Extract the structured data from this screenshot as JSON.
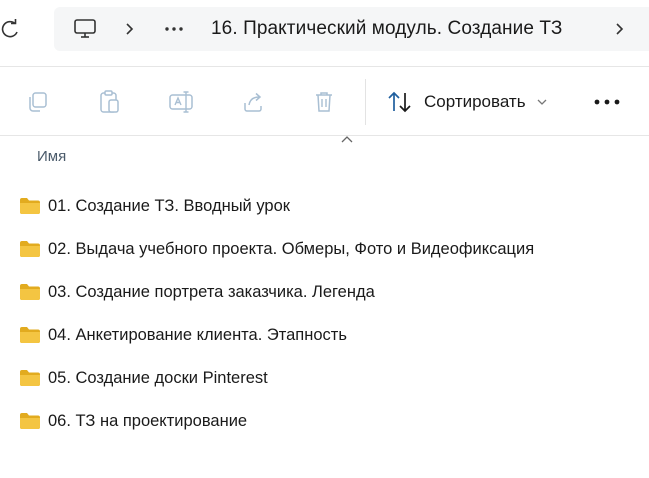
{
  "address_bar": {
    "refresh_icon": "refresh-icon",
    "location_icon": "monitor-icon",
    "separator_icon": "chevron-right-icon",
    "overflow_icon": "ellipsis-icon",
    "path_label": "16. Практический модуль. Создание ТЗ",
    "next_icon": "chevron-right-icon"
  },
  "command_bar": {
    "buttons": [
      {
        "name": "copy",
        "icon": "copy-icon",
        "enabled": false
      },
      {
        "name": "paste",
        "icon": "paste-icon",
        "enabled": false
      },
      {
        "name": "rename",
        "icon": "rename-icon",
        "enabled": false
      },
      {
        "name": "share",
        "icon": "share-icon",
        "enabled": false
      },
      {
        "name": "delete",
        "icon": "trash-icon",
        "enabled": false
      }
    ],
    "sort_label": "Сортировать",
    "more_icon": "more-dots-icon"
  },
  "list": {
    "column_header": "Имя",
    "items": [
      {
        "name": "01. Создание ТЗ. Вводный урок",
        "type": "folder"
      },
      {
        "name": "02. Выдача учебного проекта. Обмеры, Фото и Видеофиксация",
        "type": "folder"
      },
      {
        "name": "03. Создание портрета заказчика. Легенда",
        "type": "folder"
      },
      {
        "name": "04. Анкетирование клиента. Этапность",
        "type": "folder"
      },
      {
        "name": "05. Создание доски Pinterest",
        "type": "folder"
      },
      {
        "name": "06. ТЗ на проектирование",
        "type": "folder"
      }
    ]
  },
  "colors": {
    "folder": "#f4c542",
    "folder_dark": "#e2ab1f",
    "icon_disabled": "#a9bfd3",
    "icon_enabled": "#1f5f9e"
  }
}
